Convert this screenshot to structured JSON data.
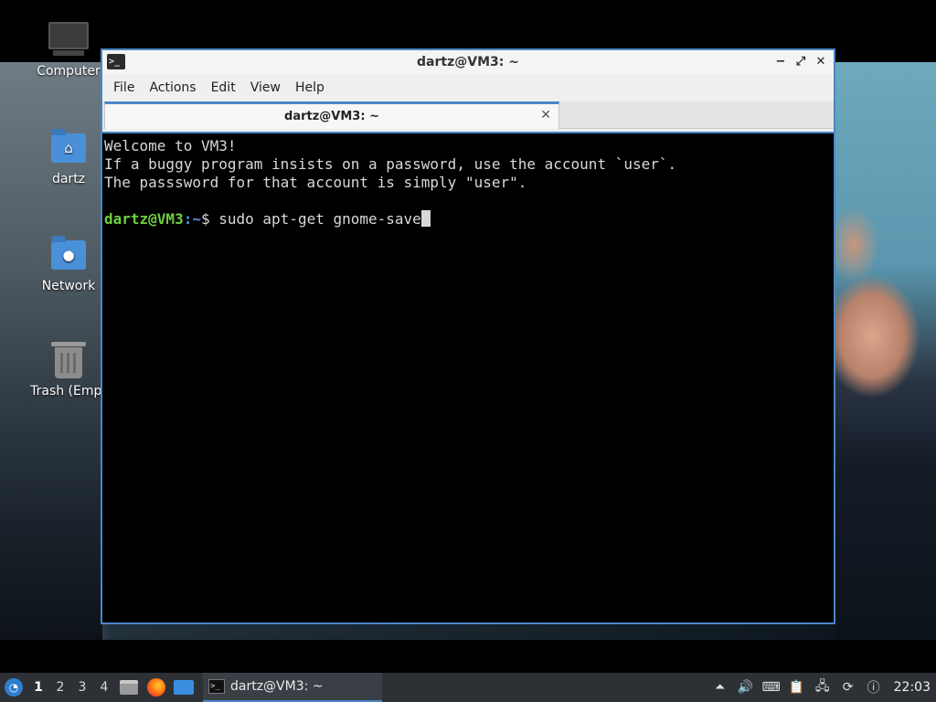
{
  "desktop": {
    "icons": [
      {
        "label": "Computer"
      },
      {
        "label": "dartz"
      },
      {
        "label": "Network"
      },
      {
        "label": "Trash (Empt"
      }
    ]
  },
  "window": {
    "title": "dartz@VM3: ~",
    "app_icon": ">_",
    "controls": {
      "minimize": "−",
      "maximize": "⤢",
      "close": "✕"
    },
    "menu": [
      "File",
      "Actions",
      "Edit",
      "View",
      "Help"
    ],
    "tab": {
      "label": "dartz@VM3: ~",
      "close": "✕"
    }
  },
  "terminal": {
    "lines": [
      "Welcome to VM3!",
      "If a buggy program insists on a password, use the account `user`.",
      "The passsword for that account is simply \"user\"."
    ],
    "prompt_user": "dartz@VM3",
    "prompt_sep": ":",
    "prompt_path": "~",
    "prompt_symbol": "$ ",
    "command": "sudo apt-get gnome-save"
  },
  "taskbar": {
    "workspaces": [
      "1",
      "2",
      "3",
      "4"
    ],
    "active_workspace": "1",
    "task_label": "dartz@VM3: ~",
    "clock": "22:03"
  }
}
